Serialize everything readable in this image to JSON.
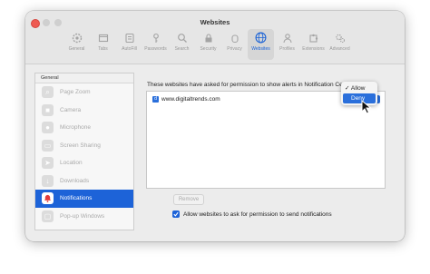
{
  "window": {
    "title": "Websites"
  },
  "toolbar": {
    "items": [
      {
        "label": "General",
        "icon": "gear-icon"
      },
      {
        "label": "Tabs",
        "icon": "tabs-icon"
      },
      {
        "label": "AutoFill",
        "icon": "autofill-icon"
      },
      {
        "label": "Passwords",
        "icon": "key-icon"
      },
      {
        "label": "Search",
        "icon": "search-icon"
      },
      {
        "label": "Security",
        "icon": "lock-icon"
      },
      {
        "label": "Privacy",
        "icon": "hand-icon"
      },
      {
        "label": "Websites",
        "icon": "globe-icon",
        "active": true
      },
      {
        "label": "Profiles",
        "icon": "person-icon"
      },
      {
        "label": "Extensions",
        "icon": "puzzle-icon"
      },
      {
        "label": "Advanced",
        "icon": "gears-icon"
      }
    ]
  },
  "sidebar": {
    "header": "General",
    "items": [
      {
        "label": "Page Zoom"
      },
      {
        "label": "Camera"
      },
      {
        "label": "Microphone"
      },
      {
        "label": "Screen Sharing"
      },
      {
        "label": "Location"
      },
      {
        "label": "Downloads"
      },
      {
        "label": "Notifications",
        "selected": true
      },
      {
        "label": "Pop-up Windows"
      }
    ]
  },
  "main": {
    "heading": "These websites have asked for permission to show alerts in Notification Centre:",
    "websites": [
      {
        "site": "www.digitaltrends.com",
        "permission": "Allow"
      }
    ],
    "popup": {
      "options": [
        "Allow",
        "Deny"
      ],
      "checked": "Allow",
      "highlighted": "Deny"
    },
    "remove_label": "Remove",
    "allow_checkbox_label": "Allow websites to ask for permission to send notifications",
    "allow_checkbox_checked": true,
    "help_label": "?"
  },
  "colors": {
    "accent": "#1d63d8",
    "close": "#ee5a52"
  }
}
